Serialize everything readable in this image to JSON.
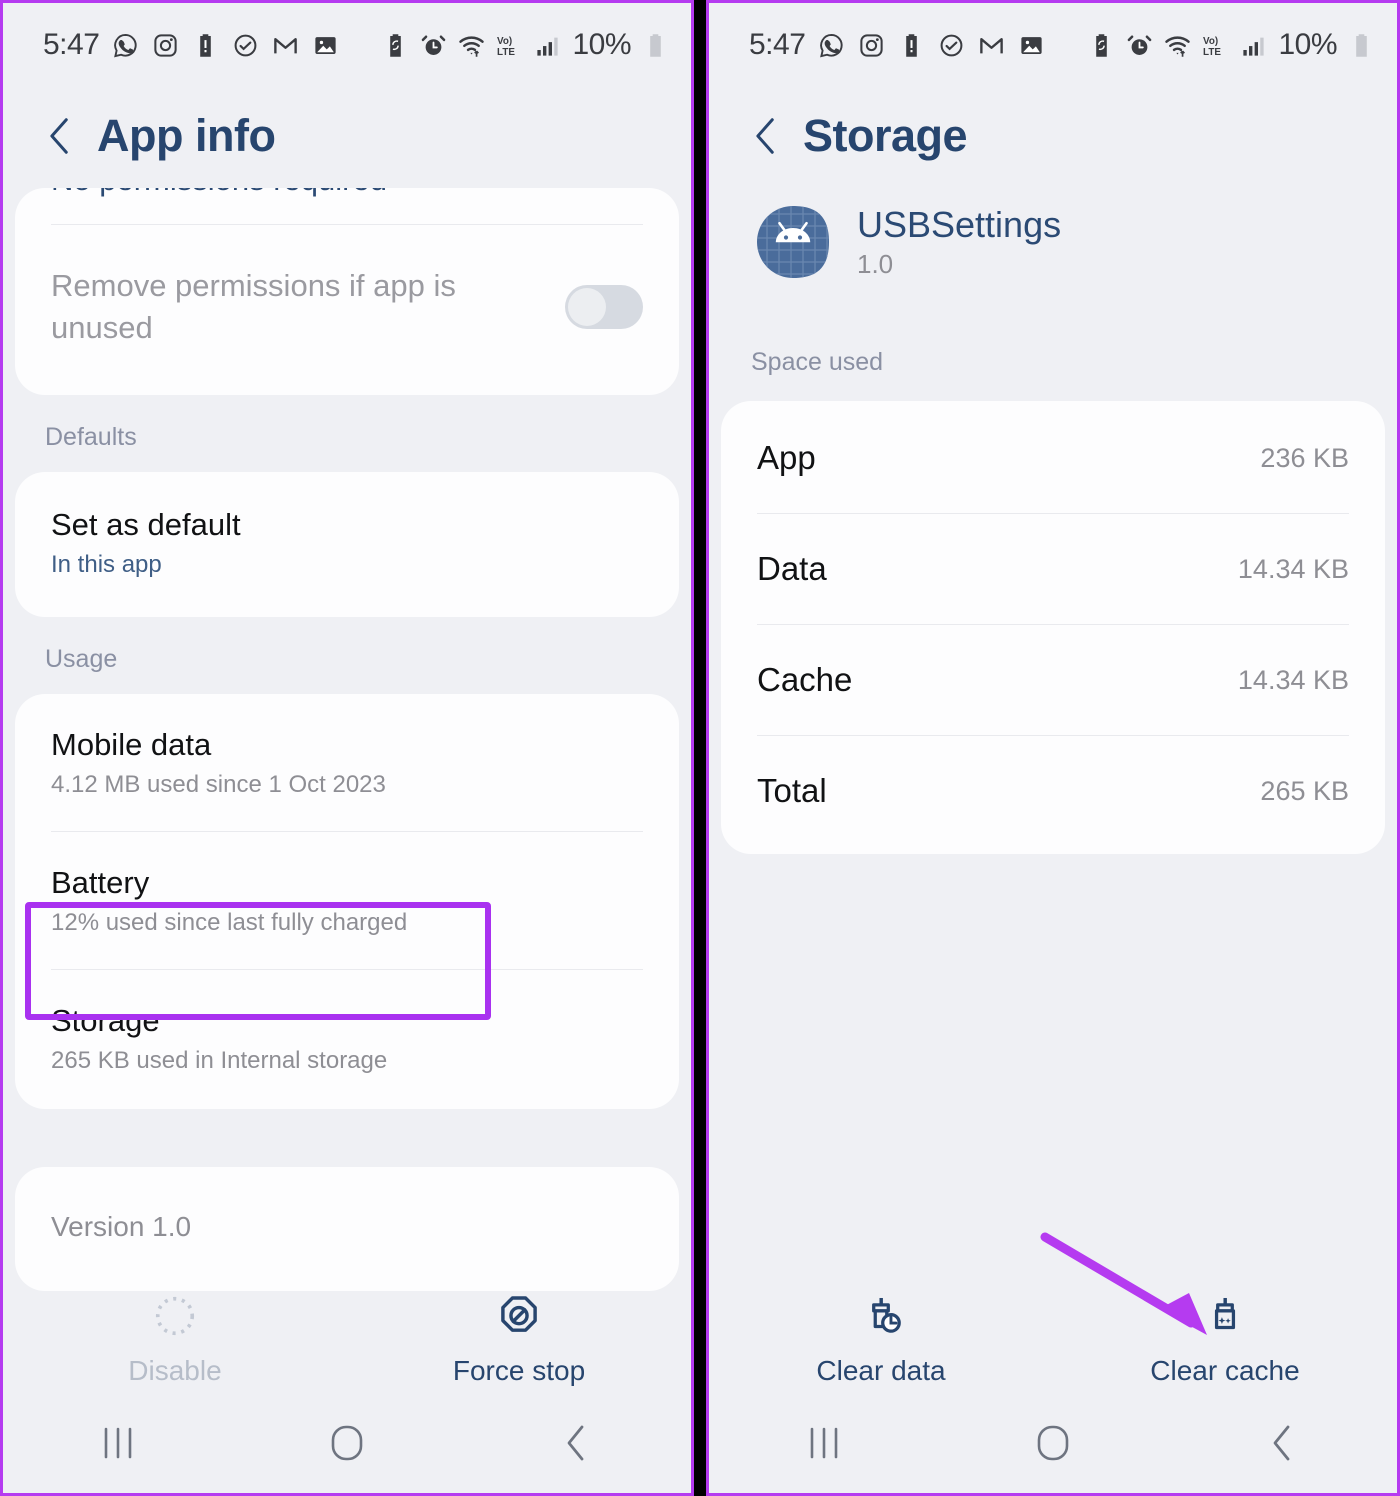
{
  "accent": {
    "highlight": "#a931f0",
    "arrow": "#b53bf0",
    "frame_border": "#b53bf0",
    "title_blue": "#27456e"
  },
  "status_bar": {
    "time": "5:47",
    "battery_percent": "10%",
    "left_icons": [
      "whatsapp-icon",
      "instagram-icon",
      "battery-alert-icon",
      "cloud-check-icon",
      "gmail-icon",
      "photo-icon"
    ],
    "right_icons": [
      "battery-saver-icon",
      "alarm-icon",
      "wifi-icon",
      "volte-icon",
      "signal-icon"
    ]
  },
  "left_panel": {
    "title": "App info",
    "back_icon": "chevron-left-icon",
    "permissions_card": {
      "clipped_text": "No permissions required",
      "toggle_label": "Remove permissions if app is unused",
      "toggle_state": "off"
    },
    "defaults": {
      "section": "Defaults",
      "title": "Set as default",
      "subtitle": "In this app"
    },
    "usage": {
      "section": "Usage",
      "rows": [
        {
          "title": "Mobile data",
          "subtitle": "4.12 MB used since 1 Oct 2023",
          "highlighted": false
        },
        {
          "title": "Battery",
          "subtitle": "12% used since last fully charged",
          "highlighted": false
        },
        {
          "title": "Storage",
          "subtitle": "265 KB used in Internal storage",
          "highlighted": true
        }
      ]
    },
    "version_card": {
      "text": "Version 1.0"
    },
    "actions": [
      {
        "label": "Disable",
        "icon": "disable-dotted-circle-icon",
        "disabled": true
      },
      {
        "label": "Force stop",
        "icon": "force-stop-octagon-icon",
        "disabled": false
      }
    ]
  },
  "right_panel": {
    "title": "Storage",
    "back_icon": "chevron-left-icon",
    "app": {
      "name": "USBSettings",
      "version": "1.0",
      "icon": "android-app-icon"
    },
    "space_used": {
      "section": "Space used",
      "rows": [
        {
          "label": "App",
          "value": "236 KB"
        },
        {
          "label": "Data",
          "value": "14.34 KB"
        },
        {
          "label": "Cache",
          "value": "14.34 KB"
        },
        {
          "label": "Total",
          "value": "265 KB"
        }
      ]
    },
    "actions": [
      {
        "label": "Clear data",
        "icon": "clear-data-broom-icon",
        "disabled": false
      },
      {
        "label": "Clear cache",
        "icon": "clear-cache-broom-icon",
        "disabled": false
      }
    ],
    "annotation_arrow": "points-to-clear-cache"
  },
  "nav_bar": {
    "recents": "recents-icon",
    "home": "home-icon",
    "back": "back-icon"
  }
}
